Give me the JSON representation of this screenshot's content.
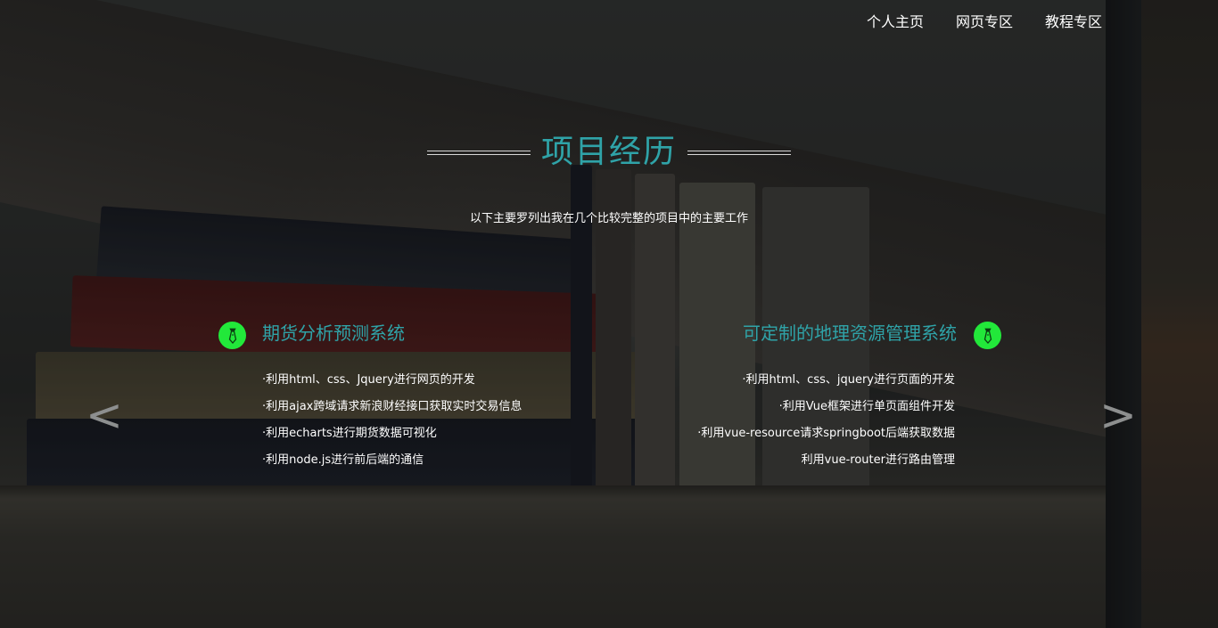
{
  "nav": {
    "items": [
      "个人主页",
      "网页专区",
      "教程专区"
    ]
  },
  "section": {
    "title": "项目经历",
    "subtitle": "以下主要罗列出我在几个比较完整的项目中的主要工作"
  },
  "projects": [
    {
      "title": "期货分析预测系统",
      "icon": "tie-icon",
      "items": [
        "·利用html、css、Jquery进行网页的开发",
        "·利用ajax跨域请求新浪财经接口获取实时交易信息",
        "·利用echarts进行期货数据可视化",
        "·利用node.js进行前后端的通信"
      ]
    },
    {
      "title": "可定制的地理资源管理系统",
      "icon": "tie-icon",
      "items": [
        "·利用html、css、jquery进行页面的开发",
        "·利用Vue框架进行单页面组件开发",
        "·利用vue-resource请求springboot后端获取数据",
        "利用vue-router进行路由管理"
      ]
    }
  ],
  "carousel": {
    "prev": "<",
    "next": ">"
  },
  "colors": {
    "accent": "#2fa3a8",
    "badge": "#22e83a",
    "text": "#ffffff",
    "arrow": "#8d8f8f"
  }
}
